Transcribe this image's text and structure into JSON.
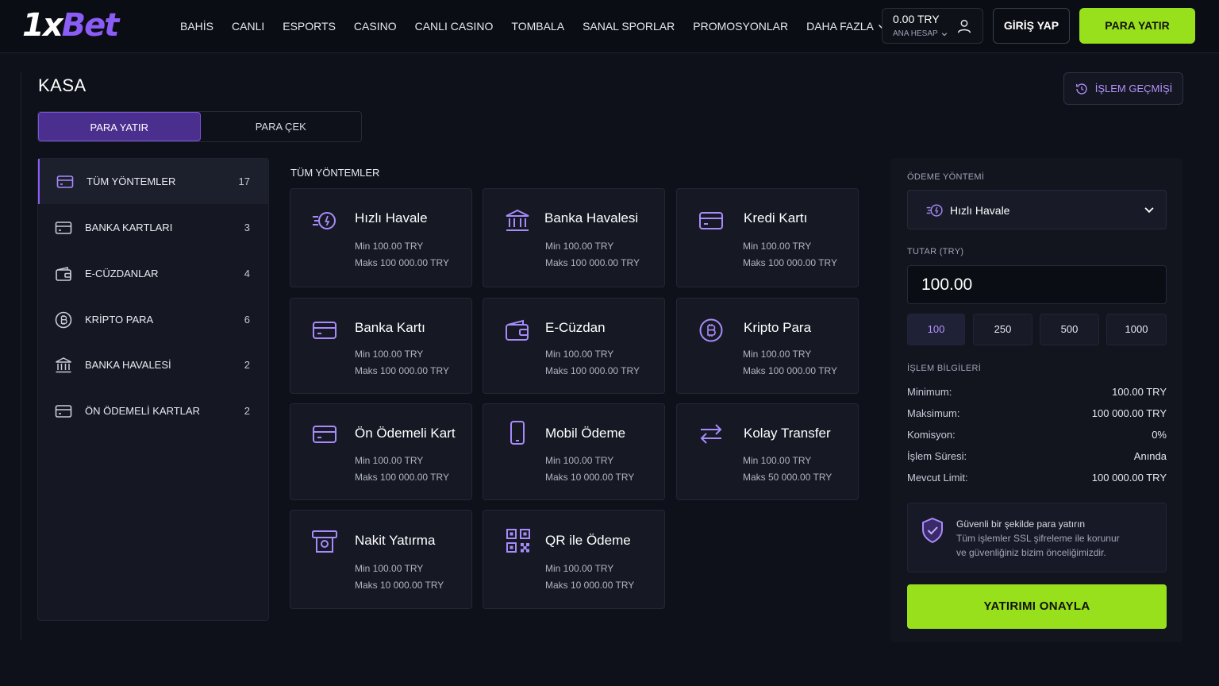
{
  "header": {
    "logo_part1": "1x",
    "logo_part2": "Bet",
    "nav": [
      "BAHİS",
      "CANLI",
      "ESPORTS",
      "CASINO",
      "CANLI CASINO",
      "TOMBALA",
      "SANAL SPORLAR",
      "PROMOSYONLAR",
      "DAHA FAZLA"
    ],
    "balance_amount": "0.00 TRY",
    "balance_account": "ANA HESAP",
    "login_label": "GİRİŞ YAP",
    "deposit_label": "PARA YATIR"
  },
  "page": {
    "title": "KASA",
    "history_label": "İŞLEM GEÇMİŞİ",
    "tabs": [
      "PARA YATIR",
      "PARA ÇEK"
    ]
  },
  "sidebar": {
    "items": [
      {
        "label": "TÜM YÖNTEMLER",
        "count": "17",
        "icon": "card-icon"
      },
      {
        "label": "BANKA KARTLARI",
        "count": "3",
        "icon": "card-icon"
      },
      {
        "label": "E-CÜZDANLAR",
        "count": "4",
        "icon": "wallet-icon"
      },
      {
        "label": "KRİPTO PARA",
        "count": "6",
        "icon": "bitcoin-icon"
      },
      {
        "label": "BANKA HAVALESİ",
        "count": "2",
        "icon": "bank-icon"
      },
      {
        "label": "ÖN ÖDEMELİ KARTLAR",
        "count": "2",
        "icon": "card-icon"
      }
    ]
  },
  "methods": {
    "title": "TÜM YÖNTEMLER",
    "cards": [
      {
        "name": "Hızlı Havale",
        "min": "Min 100.00 TRY",
        "max": "Maks 100 000.00 TRY",
        "icon": "fast-transfer-icon"
      },
      {
        "name": "Banka Havalesi",
        "min": "Min 100.00 TRY",
        "max": "Maks 100 000.00 TRY",
        "icon": "bank-icon"
      },
      {
        "name": "Kredi Kartı",
        "min": "Min 100.00 TRY",
        "max": "Maks 100 000.00 TRY",
        "icon": "card-icon"
      },
      {
        "name": "Banka Kartı",
        "min": "Min 100.00 TRY",
        "max": "Maks 100 000.00 TRY",
        "icon": "card-icon"
      },
      {
        "name": "E-Cüzdan",
        "min": "Min 100.00 TRY",
        "max": "Maks 100 000.00 TRY",
        "icon": "wallet-icon"
      },
      {
        "name": "Kripto Para",
        "min": "Min 100.00 TRY",
        "max": "Maks 100 000.00 TRY",
        "icon": "bitcoin-icon"
      },
      {
        "name": "Ön Ödemeli Kart",
        "min": "Min 100.00 TRY",
        "max": "Maks 100 000.00 TRY",
        "icon": "card-icon"
      },
      {
        "name": "Mobil Ödeme",
        "min": "Min 100.00 TRY",
        "max": "Maks 10 000.00 TRY",
        "icon": "phone-icon"
      },
      {
        "name": "Kolay Transfer",
        "min": "Min 100.00 TRY",
        "max": "Maks 50 000.00 TRY",
        "icon": "swap-arrows-icon"
      },
      {
        "name": "Nakit Yatırma",
        "min": "Min 100.00 TRY",
        "max": "Maks 10 000.00 TRY",
        "icon": "cash-icon"
      },
      {
        "name": "QR ile Ödeme",
        "min": "Min 100.00 TRY",
        "max": "Maks 10 000.00 TRY",
        "icon": "qr-icon"
      }
    ]
  },
  "panel": {
    "method_label": "ÖDEME YÖNTEMİ",
    "method_value": "Hızlı Havale",
    "amount_label": "TUTAR (TRY)",
    "amount_value": "100.00",
    "chips": [
      "100",
      "250",
      "500",
      "1000"
    ],
    "info_title": "İŞLEM BİLGİLERİ",
    "info": [
      {
        "k": "Minimum:",
        "v": "100.00 TRY"
      },
      {
        "k": "Maksimum:",
        "v": "100 000.00 TRY"
      },
      {
        "k": "Komisyon:",
        "v": "0%"
      },
      {
        "k": "İşlem Süresi:",
        "v": "Anında"
      },
      {
        "k": "Mevcut Limit:",
        "v": "100 000.00 TRY"
      }
    ],
    "secure_title": "Güvenli bir şekilde para yatırın",
    "secure_line1": "Tüm işlemler SSL şifreleme ile korunur",
    "secure_line2": "ve güvenliğiniz bizim önceliğimizdir.",
    "confirm_label": "YATIRIMI ONAYLA"
  },
  "colors": {
    "accent": "#8b5cf6",
    "cta": "#98e01c",
    "background": "#0f111a"
  }
}
